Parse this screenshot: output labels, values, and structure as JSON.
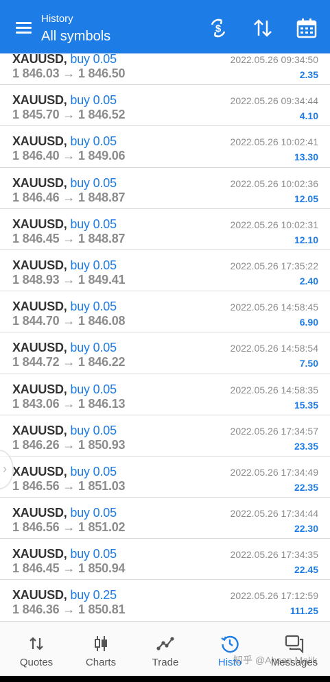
{
  "header": {
    "subtitle": "History",
    "title": "All symbols",
    "actions": [
      "dollar-exchange-icon",
      "sort-icon",
      "calendar-icon"
    ],
    "color": "#1e7ce6"
  },
  "trades": [
    {
      "symbol": "XAUUSD,",
      "side": "buy 0.05",
      "open": "1 846.03",
      "close": "1 846.50",
      "time": "2022.05.26 09:34:50",
      "profit": "2.35"
    },
    {
      "symbol": "XAUUSD,",
      "side": "buy 0.05",
      "open": "1 845.70",
      "close": "1 846.52",
      "time": "2022.05.26 09:34:44",
      "profit": "4.10"
    },
    {
      "symbol": "XAUUSD,",
      "side": "buy 0.05",
      "open": "1 846.40",
      "close": "1 849.06",
      "time": "2022.05.26 10:02:41",
      "profit": "13.30"
    },
    {
      "symbol": "XAUUSD,",
      "side": "buy 0.05",
      "open": "1 846.46",
      "close": "1 848.87",
      "time": "2022.05.26 10:02:36",
      "profit": "12.05"
    },
    {
      "symbol": "XAUUSD,",
      "side": "buy 0.05",
      "open": "1 846.45",
      "close": "1 848.87",
      "time": "2022.05.26 10:02:31",
      "profit": "12.10"
    },
    {
      "symbol": "XAUUSD,",
      "side": "buy 0.05",
      "open": "1 848.93",
      "close": "1 849.41",
      "time": "2022.05.26 17:35:22",
      "profit": "2.40"
    },
    {
      "symbol": "XAUUSD,",
      "side": "buy 0.05",
      "open": "1 844.70",
      "close": "1 846.08",
      "time": "2022.05.26 14:58:45",
      "profit": "6.90"
    },
    {
      "symbol": "XAUUSD,",
      "side": "buy 0.05",
      "open": "1 844.72",
      "close": "1 846.22",
      "time": "2022.05.26 14:58:54",
      "profit": "7.50"
    },
    {
      "symbol": "XAUUSD,",
      "side": "buy 0.05",
      "open": "1 843.06",
      "close": "1 846.13",
      "time": "2022.05.26 14:58:35",
      "profit": "15.35"
    },
    {
      "symbol": "XAUUSD,",
      "side": "buy 0.05",
      "open": "1 846.26",
      "close": "1 850.93",
      "time": "2022.05.26 17:34:57",
      "profit": "23.35"
    },
    {
      "symbol": "XAUUSD,",
      "side": "buy 0.05",
      "open": "1 846.56",
      "close": "1 851.03",
      "time": "2022.05.26 17:34:49",
      "profit": "22.35"
    },
    {
      "symbol": "XAUUSD,",
      "side": "buy 0.05",
      "open": "1 846.56",
      "close": "1 851.02",
      "time": "2022.05.26 17:34:44",
      "profit": "22.30"
    },
    {
      "symbol": "XAUUSD,",
      "side": "buy 0.05",
      "open": "1 846.45",
      "close": "1 850.94",
      "time": "2022.05.26 17:34:35",
      "profit": "22.45"
    },
    {
      "symbol": "XAUUSD,",
      "side": "buy 0.25",
      "open": "1 846.36",
      "close": "1 850.81",
      "time": "2022.05.26 17:12:59",
      "profit": "111.25"
    }
  ],
  "arrow_glyph": "→",
  "nav": [
    {
      "label": "Quotes",
      "icon": "quotes-icon",
      "active": false
    },
    {
      "label": "Charts",
      "icon": "charts-icon",
      "active": false
    },
    {
      "label": "Trade",
      "icon": "trade-icon",
      "active": false
    },
    {
      "label": "Histo",
      "icon": "history-icon",
      "active": true
    },
    {
      "label": "Messages",
      "icon": "messages-icon",
      "active": false
    }
  ],
  "watermark": "知乎 @Ahsan Malik"
}
